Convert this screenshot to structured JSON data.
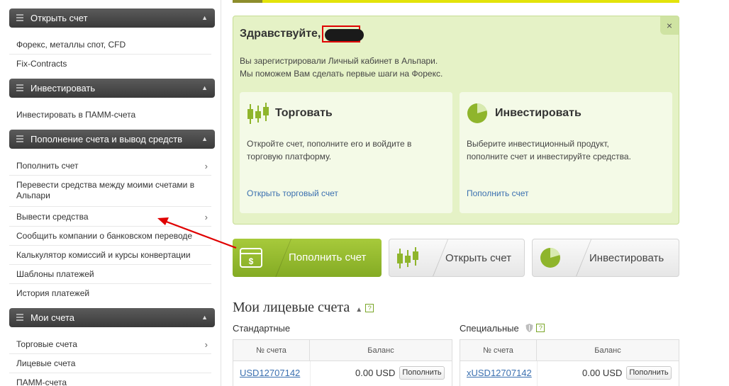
{
  "sidebar": {
    "sections": [
      {
        "title": "Открыть счет",
        "items": [
          "Форекс, металлы спот, CFD",
          "Fix-Contracts"
        ]
      },
      {
        "title": "Инвестировать",
        "items": [
          "Инвестировать в ПАММ-счета"
        ]
      },
      {
        "title": "Пополнение счета и вывод средств",
        "items": [
          "Пополнить счет",
          "Перевести средства между моими счетами в Альпари",
          "Вывести средства",
          "Сообщить компании о банковском переводе",
          "Калькулятор комиссий и курсы конвертации",
          "Шаблоны платежей",
          "История платежей"
        ]
      },
      {
        "title": "Мои счета",
        "items": [
          "Торговые счета",
          "Лицевые счета",
          "ПАММ-счета"
        ]
      }
    ]
  },
  "welcome": {
    "greeting": "Здравствуйте,",
    "intro_line1": "Вы зарегистрировали Личный кабинет в Альпари.",
    "intro_line2": "Мы поможем Вам сделать первые шаги на Форекс.",
    "trade": {
      "title": "Торговать",
      "text": "Откройте счет, пополните его и войдите в торговую платформу.",
      "link": "Открыть торговый счет"
    },
    "invest": {
      "title": "Инвестировать",
      "text": "Выберите инвестиционный продукт, пополните счет и инвестируйте средства.",
      "link": "Пополнить счет"
    },
    "close": "×"
  },
  "actions": {
    "deposit": "Пополнить счет",
    "open": "Открыть счет",
    "invest": "Инвестировать"
  },
  "accounts": {
    "title": "Мои лицевые счета",
    "help": "?",
    "standard": {
      "label": "Стандартные",
      "col_num": "№ счета",
      "col_bal": "Баланс",
      "acc": "USD12707142",
      "bal": "0.00 USD",
      "btn": "Пополнить"
    },
    "special": {
      "label": "Специальные",
      "col_num": "№ счета",
      "col_bal": "Баланс",
      "acc": "xUSD12707142",
      "bal": "0.00 USD",
      "btn": "Пополнить"
    }
  },
  "colors": {
    "accent": "#8fb52c",
    "annotation": "#e00000",
    "link": "#3b70b0"
  }
}
